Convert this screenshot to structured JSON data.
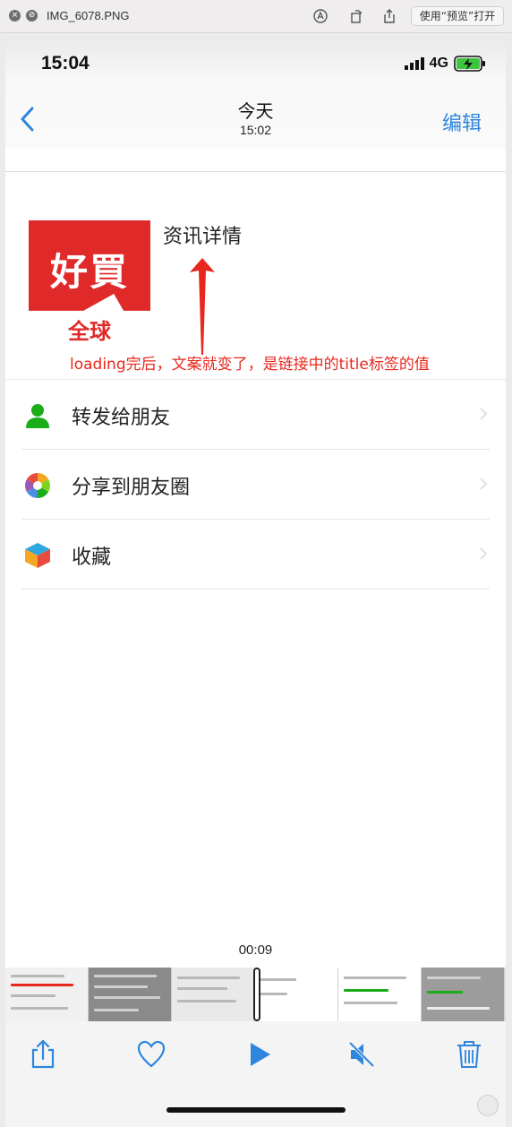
{
  "preview_bar": {
    "filename": "IMG_6078.PNG",
    "open_button": "使用“预览”打开"
  },
  "status_bar": {
    "time": "15:04",
    "network": "4G"
  },
  "nav": {
    "title": "今天",
    "subtitle": "15:02",
    "edit": "编辑"
  },
  "card": {
    "logo_top": "好買",
    "logo_bottom": "全球",
    "title": "资讯详情"
  },
  "annotation": "loading完后，文案就变了，是链接中的title标签的值",
  "menu": {
    "items": [
      {
        "label": "转发给朋友",
        "icon": "person-icon"
      },
      {
        "label": "分享到朋友圈",
        "icon": "moments-icon"
      },
      {
        "label": "收藏",
        "icon": "favorites-cube-icon"
      }
    ]
  },
  "video": {
    "time": "00:09"
  },
  "colors": {
    "accent": "#2e86de",
    "logo_red": "#e02a2a",
    "annotation_red": "#e8281d"
  }
}
